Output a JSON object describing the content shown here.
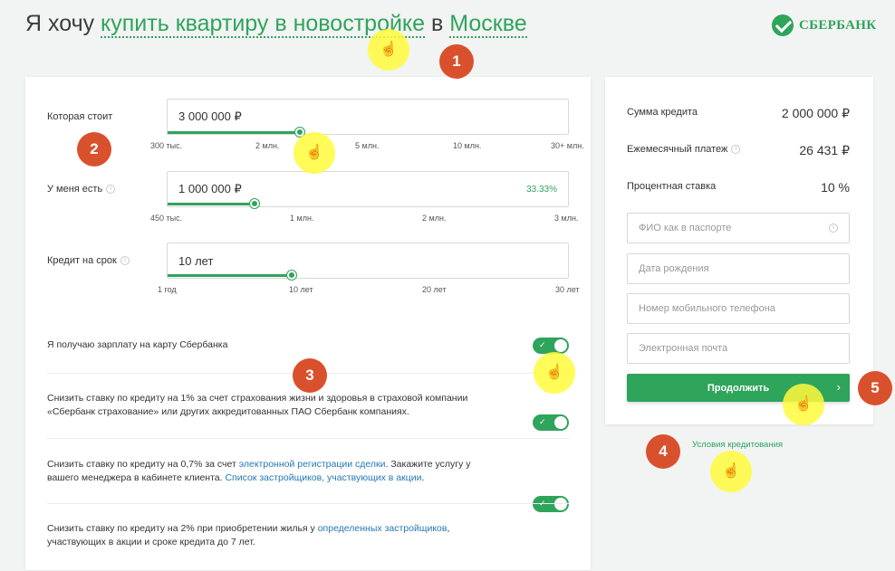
{
  "header": {
    "part1": "Я хочу ",
    "goal": "купить квартиру в новостройке",
    "part2": " в ",
    "city": "Москве",
    "logo": "СБЕРБАНК"
  },
  "calc": {
    "price": {
      "label": "Которая стоит",
      "value": "3 000 000 ₽",
      "progress_pct": 43,
      "ticks": [
        "300 тыс.",
        "2 млн.",
        "5 млн.",
        "10 млн.",
        "30+ млн."
      ]
    },
    "down": {
      "label": "У меня есть",
      "value": "1 000 000 ₽",
      "percent": "33.33%",
      "progress_pct": 21,
      "ticks": [
        "450 тыс.",
        "1 млн.",
        "2 млн.",
        "3 млн."
      ]
    },
    "term": {
      "label": "Кредит на срок",
      "value": "10 лет",
      "progress_pct": 31,
      "ticks": [
        "1 год",
        "10 лет",
        "20 лет",
        "30 лет"
      ]
    }
  },
  "options": {
    "salary": {
      "text": "Я получаю зарплату на карту Сбербанка",
      "on": true
    },
    "insurance": {
      "text": "Снизить ставку по кредиту на 1% за счет страхования жизни и здоровья в страховой компании «Сбербанк страхование» или других аккредитованных ПАО Сбербанк компаниях.",
      "on": true
    },
    "electronic": {
      "t1": "Снизить ставку по кредиту на 0,7% за счет ",
      "link1": "электронной регистрации сделки",
      "t2": ". Закажите услугу у вашего менеджера в кабинете клиента. ",
      "link2": "Список застройщиков, участвующих в акции",
      "t3": ".",
      "on": true
    },
    "developers": {
      "t1": "Снизить ставку по кредиту на 2% при приобретении жилья у ",
      "link1": "определенных застройщиков",
      "t2": ", участвующих в акции и сроке кредита до 7 лет.",
      "on": false
    }
  },
  "summary": {
    "loan_label": "Сумма кредита",
    "loan_value": "2 000 000 ₽",
    "payment_label": "Ежемесячный платеж",
    "payment_value": "26 431 ₽",
    "rate_label": "Процентная ставка",
    "rate_value": "10 %"
  },
  "form": {
    "fio": "ФИО как в паспорте",
    "birth": "Дата рождения",
    "phone": "Номер мобильного телефона",
    "email": "Электронная почта",
    "submit": "Продолжить",
    "terms_link": "Условия кредитования"
  },
  "annotations": [
    "1",
    "2",
    "3",
    "4",
    "5"
  ],
  "colors": {
    "accent": "#2fa45b",
    "badge": "#d9512c",
    "link": "#2578b5",
    "highlight": "#fffa3c"
  }
}
